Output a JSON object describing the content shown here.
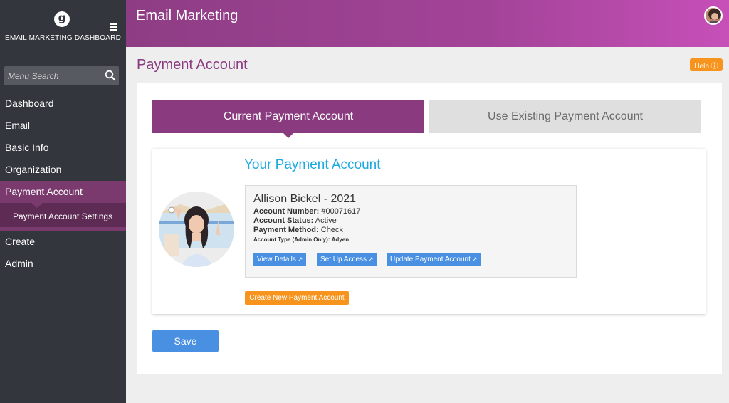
{
  "brand": {
    "logo_letter": "g",
    "name": "EMAIL MARKETING DASHBOARD"
  },
  "header": {
    "title": "Email Marketing"
  },
  "search": {
    "placeholder": "Menu Search"
  },
  "sidebar": {
    "items": [
      {
        "label": "Dashboard"
      },
      {
        "label": "Email"
      },
      {
        "label": "Basic Info"
      },
      {
        "label": "Organization"
      },
      {
        "label": "Payment Account"
      },
      {
        "label": "Create"
      },
      {
        "label": "Admin"
      }
    ],
    "subitems": [
      {
        "label": "Payment Account Settings"
      }
    ]
  },
  "page": {
    "title": "Payment Account",
    "help_label": "Help ⓘ"
  },
  "tabs": {
    "current": "Current Payment Account",
    "existing": "Use Existing Payment Account"
  },
  "account": {
    "heading": "Your Payment Account",
    "name": "Allison Bickel - 2021",
    "number_label": "Account Number:",
    "number": "#00071617",
    "status_label": "Account Status:",
    "status": "Active",
    "method_label": "Payment Method:",
    "method": "Check",
    "type_label": "Account Type (Admin Only):",
    "type": "Adyen",
    "buttons": {
      "view_details": "View Details",
      "setup_access": "Set Up Access",
      "update": "Update Payment Account"
    }
  },
  "actions": {
    "create_new": "Create New Payment Account",
    "save": "Save"
  },
  "colors": {
    "accent": "#8a3a7f",
    "link_blue": "#4a90e2",
    "orange": "#f7941d",
    "heading_blue": "#1ca9e1",
    "sidebar_bg": "#33363d"
  },
  "icons": {
    "search": "search-icon",
    "menu": "hamburger-icon",
    "external": "external-link-icon"
  }
}
